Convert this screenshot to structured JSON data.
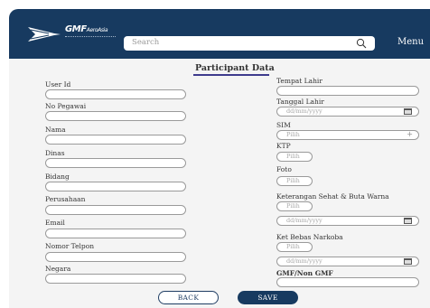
{
  "header": {
    "logo_text": "GMF",
    "logo_text_suffix": "AeroAsia",
    "search_placeholder": "Search",
    "menu_label": "Menu"
  },
  "form": {
    "title": "Participant Data",
    "left": [
      {
        "key": "user_id",
        "label": "User Id"
      },
      {
        "key": "no_pegawai",
        "label": "No Pegawai"
      },
      {
        "key": "nama",
        "label": "Nama"
      },
      {
        "key": "dinas",
        "label": "Dinas"
      },
      {
        "key": "bidang",
        "label": "Bidang"
      },
      {
        "key": "perusahaan",
        "label": "Perusahaan"
      },
      {
        "key": "email",
        "label": "Email"
      },
      {
        "key": "nomor_telpon",
        "label": "Nomor Telpon"
      },
      {
        "key": "negara",
        "label": "Negara"
      }
    ],
    "right": {
      "tempat_lahir": {
        "label": "Tempat Lahir"
      },
      "tanggal_lahir": {
        "label": "Tanggal Lahir",
        "placeholder": "dd/mm/yyyy"
      },
      "sim": {
        "label": "SIM",
        "placeholder": "Pilih",
        "add": "+"
      },
      "ktp": {
        "label": "KTP",
        "placeholder": "Pilih"
      },
      "foto": {
        "label": "Foto",
        "placeholder": "Pilih"
      },
      "keterangan": {
        "label": "Keterangan Sehat & Buta Warna",
        "placeholder": "Pilih",
        "date_placeholder": "dd/mm/yyyy"
      },
      "narkoba": {
        "label": "Ket Bebas Narkoba",
        "placeholder": "Pilih",
        "date_placeholder": "dd/mm/yyyy"
      },
      "gmf": {
        "label": "GMF/Non GMF"
      }
    }
  },
  "buttons": {
    "back": "BACK",
    "save": "SAVE"
  },
  "colors": {
    "header": "#173a60",
    "panel": "#f4f4f4",
    "accent_underline": "#3e3b8d"
  }
}
